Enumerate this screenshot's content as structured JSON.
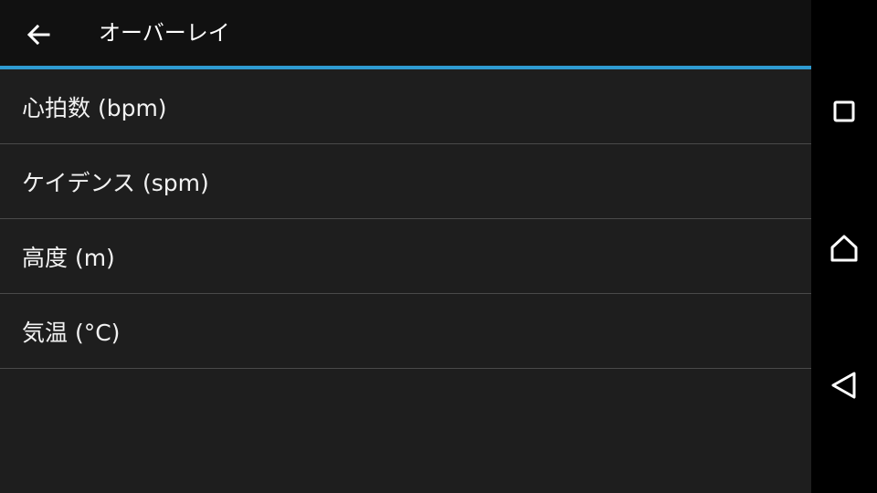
{
  "app_bar": {
    "title": "オーバーレイ",
    "back_icon": "arrow-left-icon"
  },
  "list": {
    "items": [
      {
        "label": "心拍数 (bpm)"
      },
      {
        "label": "ケイデンス (spm)"
      },
      {
        "label": "高度 (m)"
      },
      {
        "label": "気温 (°C)"
      }
    ]
  },
  "nav_bar": {
    "recent_icon": "square-icon",
    "home_icon": "home-icon",
    "back_icon": "triangle-back-icon"
  },
  "colors": {
    "accent": "#2e9bd1",
    "background": "#1e1e1e",
    "app_bar": "#111111",
    "nav_bar": "#000000",
    "divider": "#4a4a4a"
  }
}
